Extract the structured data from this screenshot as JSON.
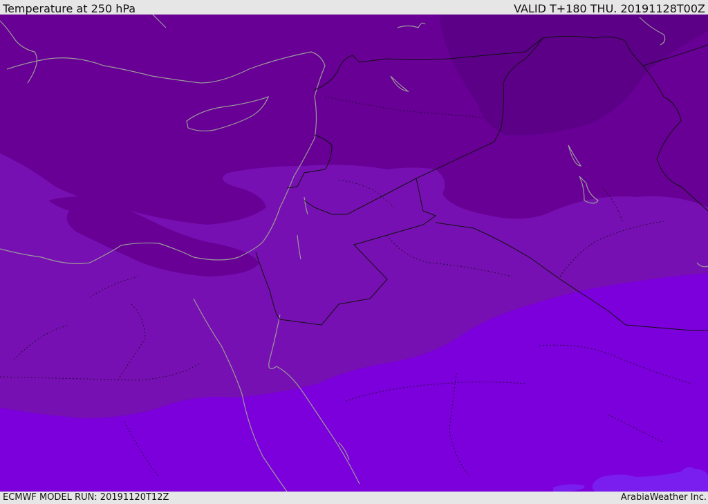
{
  "header": {
    "title": "Temperature at 250 hPa",
    "valid_time": "VALID T+180 THU. 20191128T00Z"
  },
  "footer": {
    "model_run": "ECMWF MODEL RUN: 20191120T12Z",
    "credit": "ArabiaWeather Inc."
  },
  "colors": {
    "band_darkest": "#5c0088",
    "band_dark": "#680096",
    "band_mid": "#7710b2",
    "band_light": "#7c00dc",
    "band_lightest": "#7a1ef0",
    "coastline": "#9a9a9a",
    "border": "#111111"
  }
}
